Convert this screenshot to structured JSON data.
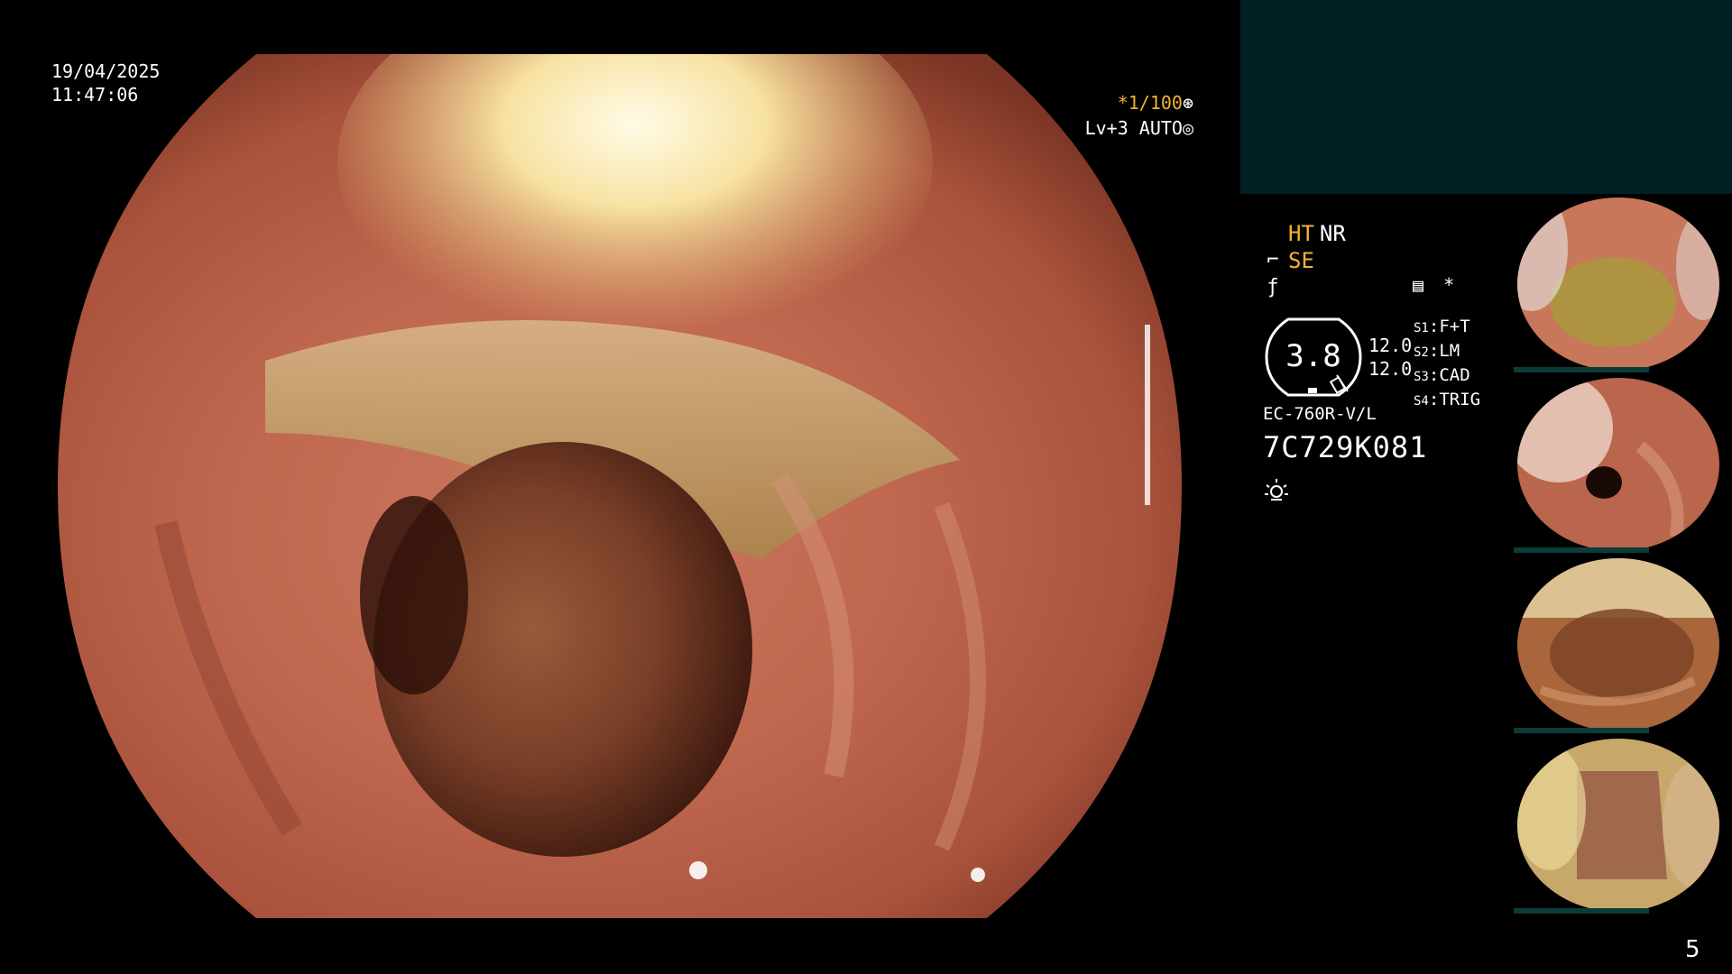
{
  "datetime": {
    "date": "19/04/2025",
    "time": "11:47:06"
  },
  "top_right": {
    "shutter": "*1/100",
    "shutter_icon": "aperture-icon",
    "level": "Lv+3 AUTO",
    "level_icon": "iris-icon"
  },
  "mode": {
    "ht_label": "HT",
    "nr_label": "NR",
    "se_label": "SE",
    "se_icon": "enhance-icon",
    "f_icon": "function-icon"
  },
  "icons": {
    "record_icon": "record-icon",
    "star": "*"
  },
  "gauge": {
    "value": "3.8",
    "side_top": "12.0",
    "side_bottom": "12.0"
  },
  "switches": [
    {
      "key": "S1",
      "value": "F+T"
    },
    {
      "key": "S2",
      "value": "LM"
    },
    {
      "key": "S3",
      "value": "CAD"
    },
    {
      "key": "S4",
      "value": "TRIG"
    }
  ],
  "scope": {
    "model": "EC-760R-V/L",
    "serial": "7C729K081",
    "light_icon": "light-icon"
  },
  "thumbnails": [
    {
      "label": "thumbnail-1"
    },
    {
      "label": "thumbnail-2"
    },
    {
      "label": "thumbnail-3"
    },
    {
      "label": "thumbnail-4"
    }
  ],
  "page_number": "5",
  "colors": {
    "accent": "#f2b233",
    "panel": "#002025",
    "text": "#ffffff"
  }
}
